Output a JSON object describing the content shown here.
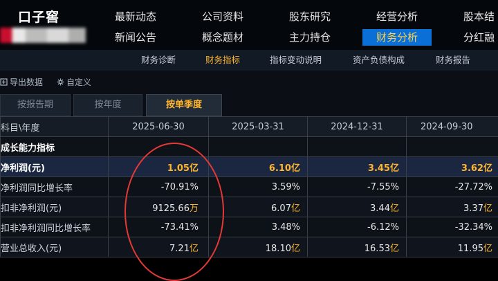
{
  "header": {
    "stock_name": "口子窖",
    "nav_rows": [
      [
        "最新动态",
        "公司资料",
        "股东研究",
        "经营分析",
        "股本结"
      ],
      [
        "新闻公告",
        "概念题材",
        "主力持仓",
        "财务分析",
        "分红融"
      ]
    ],
    "active_nav": "财务分析"
  },
  "subnav": {
    "items": [
      "财务诊断",
      "财务指标",
      "指标变动说明",
      "资产负债构成",
      "财务报告"
    ],
    "active": "财务指标"
  },
  "toolbar": {
    "export_label": "导出数据",
    "custom_label": "自定义"
  },
  "tabs": {
    "items": [
      "按报告期",
      "按年度",
      "按单季度"
    ],
    "active": "按单季度"
  },
  "table": {
    "corner_label": "科目\\年度",
    "columns": [
      "2025-06-30",
      "2025-03-31",
      "2024-12-31",
      "2024-09-30"
    ],
    "section_label": "成长能力指标",
    "rows": [
      {
        "label": "净利润(元)",
        "values": [
          [
            "1.05",
            "亿"
          ],
          [
            "6.10",
            "亿"
          ],
          [
            "3.45",
            "亿"
          ],
          [
            "3.62",
            "亿"
          ]
        ]
      },
      {
        "label": "净利润同比增长率",
        "values": [
          [
            "-70.91%",
            ""
          ],
          [
            "3.59%",
            ""
          ],
          [
            "-7.55%",
            ""
          ],
          [
            "-27.72%",
            ""
          ]
        ]
      },
      {
        "label": "扣非净利润(元)",
        "values": [
          [
            "9125.66",
            "万"
          ],
          [
            "6.07",
            "亿"
          ],
          [
            "3.44",
            "亿"
          ],
          [
            "3.37",
            "亿"
          ]
        ]
      },
      {
        "label": "扣非净利润同比增长率",
        "values": [
          [
            "-73.41%",
            ""
          ],
          [
            "3.48%",
            ""
          ],
          [
            "-6.12%",
            ""
          ],
          [
            "-32.34%",
            ""
          ]
        ]
      },
      {
        "label": "营业总收入(元)",
        "values": [
          [
            "7.21",
            "亿"
          ],
          [
            "18.10",
            "亿"
          ],
          [
            "16.53",
            "亿"
          ],
          [
            "11.95",
            "亿"
          ]
        ]
      }
    ]
  },
  "colors": {
    "accent": "#ffb62e",
    "active_nav_bg": "#0a6fd6",
    "annotation": "#e53935"
  }
}
